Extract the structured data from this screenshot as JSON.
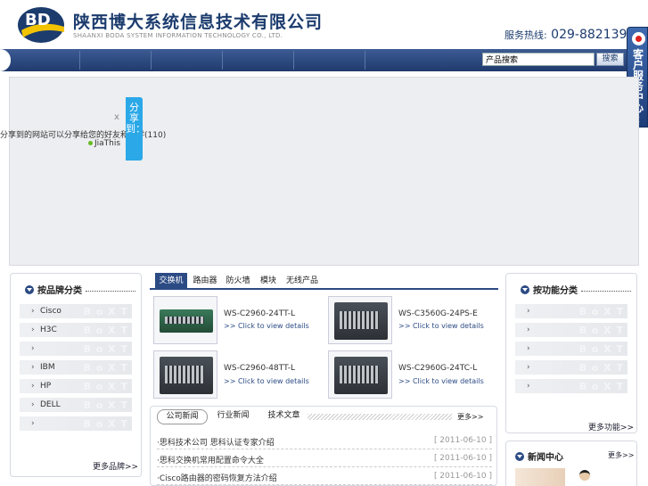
{
  "header": {
    "company_cn": "陕西博大系统信息技术有限公司",
    "company_en": "SHAANXI BODA SYSTEM INFORMATION TECHNOLOGY CO., LTD.",
    "hotline_label": "服务热线:",
    "hotline_number": "029-882139"
  },
  "search": {
    "value": "产品搜索",
    "button_label": "搜索"
  },
  "customer_service": {
    "label": "客户服务中心",
    "close": "×"
  },
  "share": {
    "close": "x",
    "text": "分享到的网站可以分享给您的好友和同学(110)",
    "provider": "JiaThis",
    "tab_label": "分享到："
  },
  "brand_panel": {
    "title": "按品牌分类",
    "items": [
      "Cisco",
      "H3C",
      "",
      "IBM",
      "HP",
      "DELL",
      ""
    ],
    "more": "更多品牌>>"
  },
  "func_panel": {
    "title": "按功能分类",
    "items": [
      "",
      "",
      "",
      "",
      ""
    ],
    "more": "更多功能>>"
  },
  "product_tabs": [
    "交换机",
    "路由器",
    "防火墙",
    "模块",
    "无线产品"
  ],
  "products": [
    {
      "name": "WS-C2960-24TT-L",
      "link": ">> Click to view details"
    },
    {
      "name": "WS-C3560G-24PS-E",
      "link": ">> Click to view details"
    },
    {
      "name": "WS-C2960-48TT-L",
      "link": ">> Click to view details"
    },
    {
      "name": "WS-C2960G-24TC-L",
      "link": ">> Click to view details"
    }
  ],
  "news": {
    "tabs": [
      "公司新闻",
      "行业新闻",
      "技术文章"
    ],
    "more": "更多>>",
    "rows": [
      {
        "title": "·思科技术公司 思科认证专家介绍",
        "date": "[ 2011-06-10 ]"
      },
      {
        "title": "·思科交换机常用配置命令大全",
        "date": "[ 2011-06-10 ]"
      },
      {
        "title": "·Cisco路由器的密码恢复方法介绍",
        "date": "[ 2011-06-10 ]"
      }
    ]
  },
  "news_center": {
    "title": "新闻中心",
    "more": "更多>>"
  }
}
